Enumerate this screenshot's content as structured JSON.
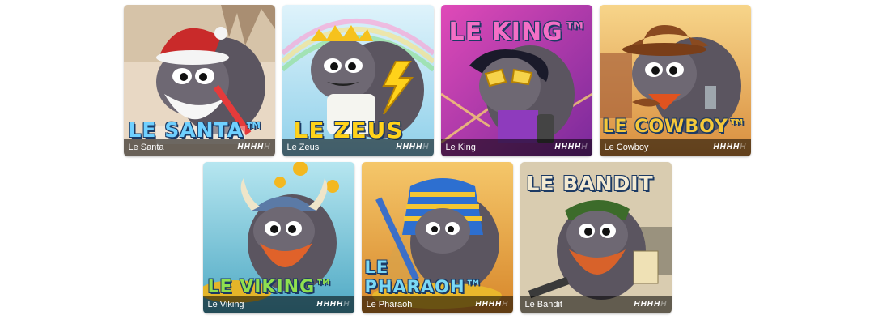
{
  "games": [
    {
      "name": "Le Santa",
      "logo_text": "LE SANTA™",
      "rating": 4,
      "colors": {
        "bg": "#e8d8c4",
        "accent": "#c92a2a",
        "logo": "#6fd0ff"
      }
    },
    {
      "name": "Le Zeus",
      "logo_text": "LE ZEUS",
      "rating": 4,
      "colors": {
        "bg": "#bfe6f5",
        "accent": "#f6c21c",
        "logo": "#ffd21a"
      }
    },
    {
      "name": "Le King",
      "logo_text": "LE KING™",
      "rating": 4,
      "colors": {
        "bg": "#c0379b",
        "accent": "#f6d34a",
        "logo": "#f46fc6"
      }
    },
    {
      "name": "Le Cowboy",
      "logo_text": "LE COWBOY™",
      "rating": 4,
      "colors": {
        "bg": "#e9b469",
        "accent": "#8a4a20",
        "logo": "#f5c83a"
      }
    },
    {
      "name": "Le Viking",
      "logo_text": "LE VIKING™",
      "rating": 4,
      "colors": {
        "bg": "#7fc9d8",
        "accent": "#e0622a",
        "logo": "#8fe04f"
      }
    },
    {
      "name": "Le Pharaoh",
      "logo_text": "LE PHARAOH™",
      "rating": 4,
      "colors": {
        "bg": "#e8a93c",
        "accent": "#2d6fd0",
        "logo": "#7ad8f5"
      }
    },
    {
      "name": "Le Bandit",
      "logo_text": "LE BANDIT",
      "rating": 4,
      "colors": {
        "bg": "#d9ccb0",
        "accent": "#3c6b2a",
        "logo": "#f3ead2"
      }
    }
  ],
  "rating_max": 5,
  "rating_glyph": "H"
}
